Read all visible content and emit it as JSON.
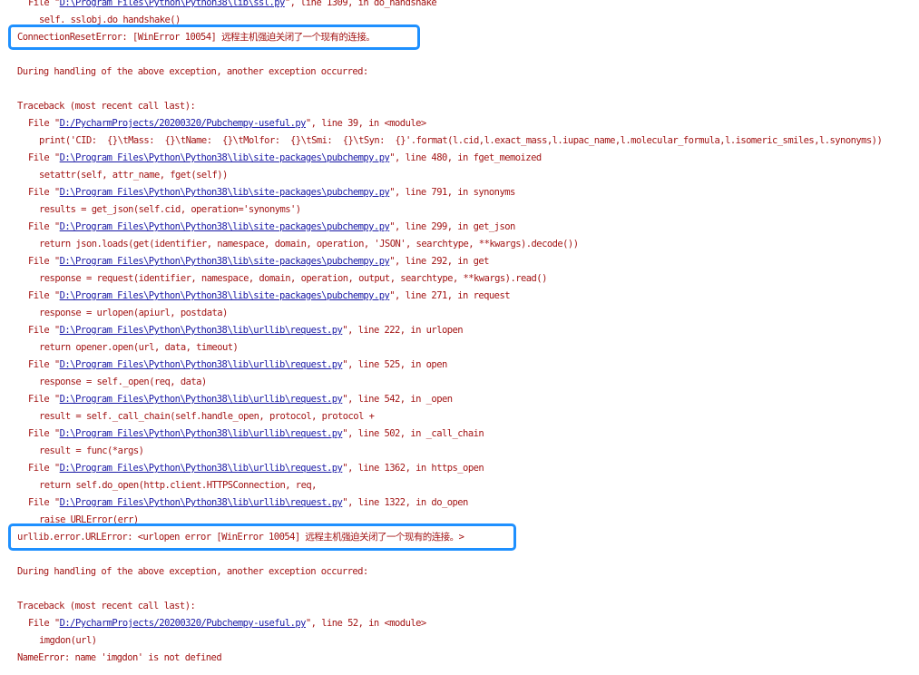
{
  "console": {
    "top_lines": [
      {
        "kind": "file",
        "pre": "File \"",
        "link": "D:\\Program Files\\Python\\Python38\\lib\\ssl.py",
        "post": "\", line 1309, in do_handshake"
      },
      {
        "kind": "code",
        "text": "self._sslobj.do_handshake()"
      }
    ],
    "error1": "ConnectionResetError: [WinError 10054] 远程主机强迫关闭了一个现有的连接。",
    "during1": "During handling of the above exception, another exception occurred:",
    "traceback1_header": "Traceback (most recent call last):",
    "traceback1": [
      {
        "kind": "file",
        "pre": "File \"",
        "link": "D:/PycharmProjects/20200320/Pubchempy-useful.py",
        "post": "\", line 39, in <module>"
      },
      {
        "kind": "code",
        "text": "print('CID:  {}\\tMass:  {}\\tName:  {}\\tMolfor:  {}\\tSmi:  {}\\tSyn:  {}'.format(l.cid,l.exact_mass,l.iupac_name,l.molecular_formula,l.isomeric_smiles,l.synonyms))"
      },
      {
        "kind": "file",
        "pre": "File \"",
        "link": "D:\\Program Files\\Python\\Python38\\lib\\site-packages\\pubchempy.py",
        "post": "\", line 480, in fget_memoized"
      },
      {
        "kind": "code",
        "text": "setattr(self, attr_name, fget(self))"
      },
      {
        "kind": "file",
        "pre": "File \"",
        "link": "D:\\Program Files\\Python\\Python38\\lib\\site-packages\\pubchempy.py",
        "post": "\", line 791, in synonyms"
      },
      {
        "kind": "code",
        "text": "results = get_json(self.cid, operation='synonyms')"
      },
      {
        "kind": "file",
        "pre": "File \"",
        "link": "D:\\Program Files\\Python\\Python38\\lib\\site-packages\\pubchempy.py",
        "post": "\", line 299, in get_json"
      },
      {
        "kind": "code",
        "text": "return json.loads(get(identifier, namespace, domain, operation, 'JSON', searchtype, **kwargs).decode())"
      },
      {
        "kind": "file",
        "pre": "File \"",
        "link": "D:\\Program Files\\Python\\Python38\\lib\\site-packages\\pubchempy.py",
        "post": "\", line 292, in get"
      },
      {
        "kind": "code",
        "text": "response = request(identifier, namespace, domain, operation, output, searchtype, **kwargs).read()"
      },
      {
        "kind": "file",
        "pre": "File \"",
        "link": "D:\\Program Files\\Python\\Python38\\lib\\site-packages\\pubchempy.py",
        "post": "\", line 271, in request"
      },
      {
        "kind": "code",
        "text": "response = urlopen(apiurl, postdata)"
      },
      {
        "kind": "file",
        "pre": "File \"",
        "link": "D:\\Program Files\\Python\\Python38\\lib\\urllib\\request.py",
        "post": "\", line 222, in urlopen"
      },
      {
        "kind": "code",
        "text": "return opener.open(url, data, timeout)"
      },
      {
        "kind": "file",
        "pre": "File \"",
        "link": "D:\\Program Files\\Python\\Python38\\lib\\urllib\\request.py",
        "post": "\", line 525, in open"
      },
      {
        "kind": "code",
        "text": "response = self._open(req, data)"
      },
      {
        "kind": "file",
        "pre": "File \"",
        "link": "D:\\Program Files\\Python\\Python38\\lib\\urllib\\request.py",
        "post": "\", line 542, in _open"
      },
      {
        "kind": "code",
        "text": "result = self._call_chain(self.handle_open, protocol, protocol +"
      },
      {
        "kind": "file",
        "pre": "File \"",
        "link": "D:\\Program Files\\Python\\Python38\\lib\\urllib\\request.py",
        "post": "\", line 502, in _call_chain"
      },
      {
        "kind": "code",
        "text": "result = func(*args)"
      },
      {
        "kind": "file",
        "pre": "File \"",
        "link": "D:\\Program Files\\Python\\Python38\\lib\\urllib\\request.py",
        "post": "\", line 1362, in https_open"
      },
      {
        "kind": "code",
        "text": "return self.do_open(http.client.HTTPSConnection, req,"
      },
      {
        "kind": "file",
        "pre": "File \"",
        "link": "D:\\Program Files\\Python\\Python38\\lib\\urllib\\request.py",
        "post": "\", line 1322, in do_open"
      },
      {
        "kind": "code",
        "text": "raise URLError(err)"
      }
    ],
    "error2": "urllib.error.URLError: <urlopen error [WinError 10054] 远程主机强迫关闭了一个现有的连接。>",
    "during2": "During handling of the above exception, another exception occurred:",
    "traceback2_header": "Traceback (most recent call last):",
    "traceback2": [
      {
        "kind": "file",
        "pre": "File \"",
        "link": "D:/PycharmProjects/20200320/Pubchempy-useful.py",
        "post": "\", line 52, in <module>"
      },
      {
        "kind": "code",
        "text": "imgdon(url)"
      }
    ],
    "error3": "NameError: name 'imgdon' is not defined"
  },
  "colors": {
    "text": "#a31515",
    "link": "#1a1aa6",
    "highlight_border": "#1e90ff",
    "background": "#ffffff"
  }
}
